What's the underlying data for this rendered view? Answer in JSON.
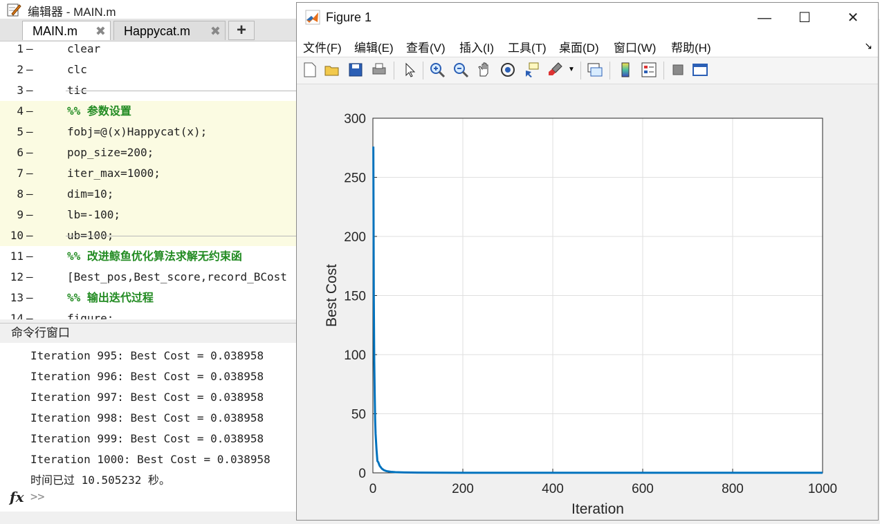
{
  "editor": {
    "title": "编辑器 - MAIN.m",
    "tabs": [
      {
        "label": "MAIN.m",
        "close": "✖"
      },
      {
        "label": "Happycat.m",
        "close": "✖"
      }
    ],
    "add_tab": "+",
    "lines": [
      {
        "num": "1",
        "code": "clear",
        "style": "code"
      },
      {
        "num": "2",
        "code": "clc",
        "style": "code"
      },
      {
        "num": "3",
        "code": "tic",
        "style": "code"
      },
      {
        "num": "4",
        "code": "%% 参数设置",
        "style": "comment"
      },
      {
        "num": "5",
        "code": "fobj=@(x)Happycat(x);",
        "style": "cell"
      },
      {
        "num": "6",
        "code": "pop_size=200;",
        "style": "cell"
      },
      {
        "num": "7",
        "code": "iter_max=1000;",
        "style": "cell"
      },
      {
        "num": "8",
        "code": "dim=10;",
        "style": "cell"
      },
      {
        "num": "9",
        "code": "lb=-100;",
        "style": "cell"
      },
      {
        "num": "10",
        "code": "ub=100;",
        "style": "cell"
      },
      {
        "num": "11",
        "code": "%% 改进鲸鱼优化算法求解无约束函",
        "style": "comment"
      },
      {
        "num": "12",
        "code": "[Best_pos,Best_score,record_BCost",
        "style": "code"
      },
      {
        "num": "13",
        "code": "%% 输出迭代过程",
        "style": "comment"
      },
      {
        "num": "14",
        "code": "figure;",
        "style": "code"
      }
    ]
  },
  "command_window": {
    "title": "命令行窗口",
    "lines": [
      "Iteration 995: Best Cost = 0.038958",
      "Iteration 996: Best Cost = 0.038958",
      "Iteration 997: Best Cost = 0.038958",
      "Iteration 998: Best Cost = 0.038958",
      "Iteration 999: Best Cost = 0.038958",
      "Iteration 1000: Best Cost = 0.038958",
      "时间已过 10.505232 秒。"
    ],
    "prompt_fx": "fx",
    "prompt": ">>"
  },
  "figure": {
    "title": "Figure 1",
    "window_buttons": {
      "minimize": "—",
      "maximize": "☐",
      "close": "✕"
    },
    "menus": [
      "文件(F)",
      "编辑(E)",
      "查看(V)",
      "插入(I)",
      "工具(T)",
      "桌面(D)",
      "窗口(W)",
      "帮助(H)"
    ],
    "menu_overflow": "↘",
    "toolbar": [
      "new-figure-icon",
      "open-icon",
      "save-icon",
      "print-icon",
      "pointer-icon",
      "zoom-in-icon",
      "zoom-out-icon",
      "pan-icon",
      "rotate-icon",
      "data-cursor-icon",
      "brush-icon",
      "link-icon",
      "colorbar-icon",
      "legend-icon",
      "hide-tools-icon",
      "show-tools-icon"
    ]
  },
  "colors": {
    "line": "#0072bd",
    "cell_bg": "#fbfbe2",
    "comment": "#228b22"
  },
  "chart_data": {
    "type": "line",
    "xlabel": "Iteration",
    "ylabel": "Best Cost",
    "xlim": [
      0,
      1000
    ],
    "ylim": [
      0,
      300
    ],
    "xticks": [
      0,
      200,
      400,
      600,
      800,
      1000
    ],
    "yticks": [
      0,
      50,
      100,
      150,
      200,
      250,
      300
    ],
    "grid": true,
    "series": [
      {
        "x": [
          1,
          2,
          3,
          4,
          5,
          6,
          8,
          10,
          12,
          15,
          20,
          25,
          30,
          40,
          50,
          70,
          100,
          150,
          200,
          300,
          400,
          500,
          600,
          700,
          800,
          900,
          1000
        ],
        "y": [
          276,
          150,
          95,
          68,
          45,
          33,
          20,
          10,
          9,
          6,
          3.5,
          2.2,
          1.5,
          0.9,
          0.6,
          0.35,
          0.2,
          0.12,
          0.09,
          0.06,
          0.05,
          0.045,
          0.042,
          0.04,
          0.039,
          0.039,
          0.038958
        ]
      }
    ]
  }
}
